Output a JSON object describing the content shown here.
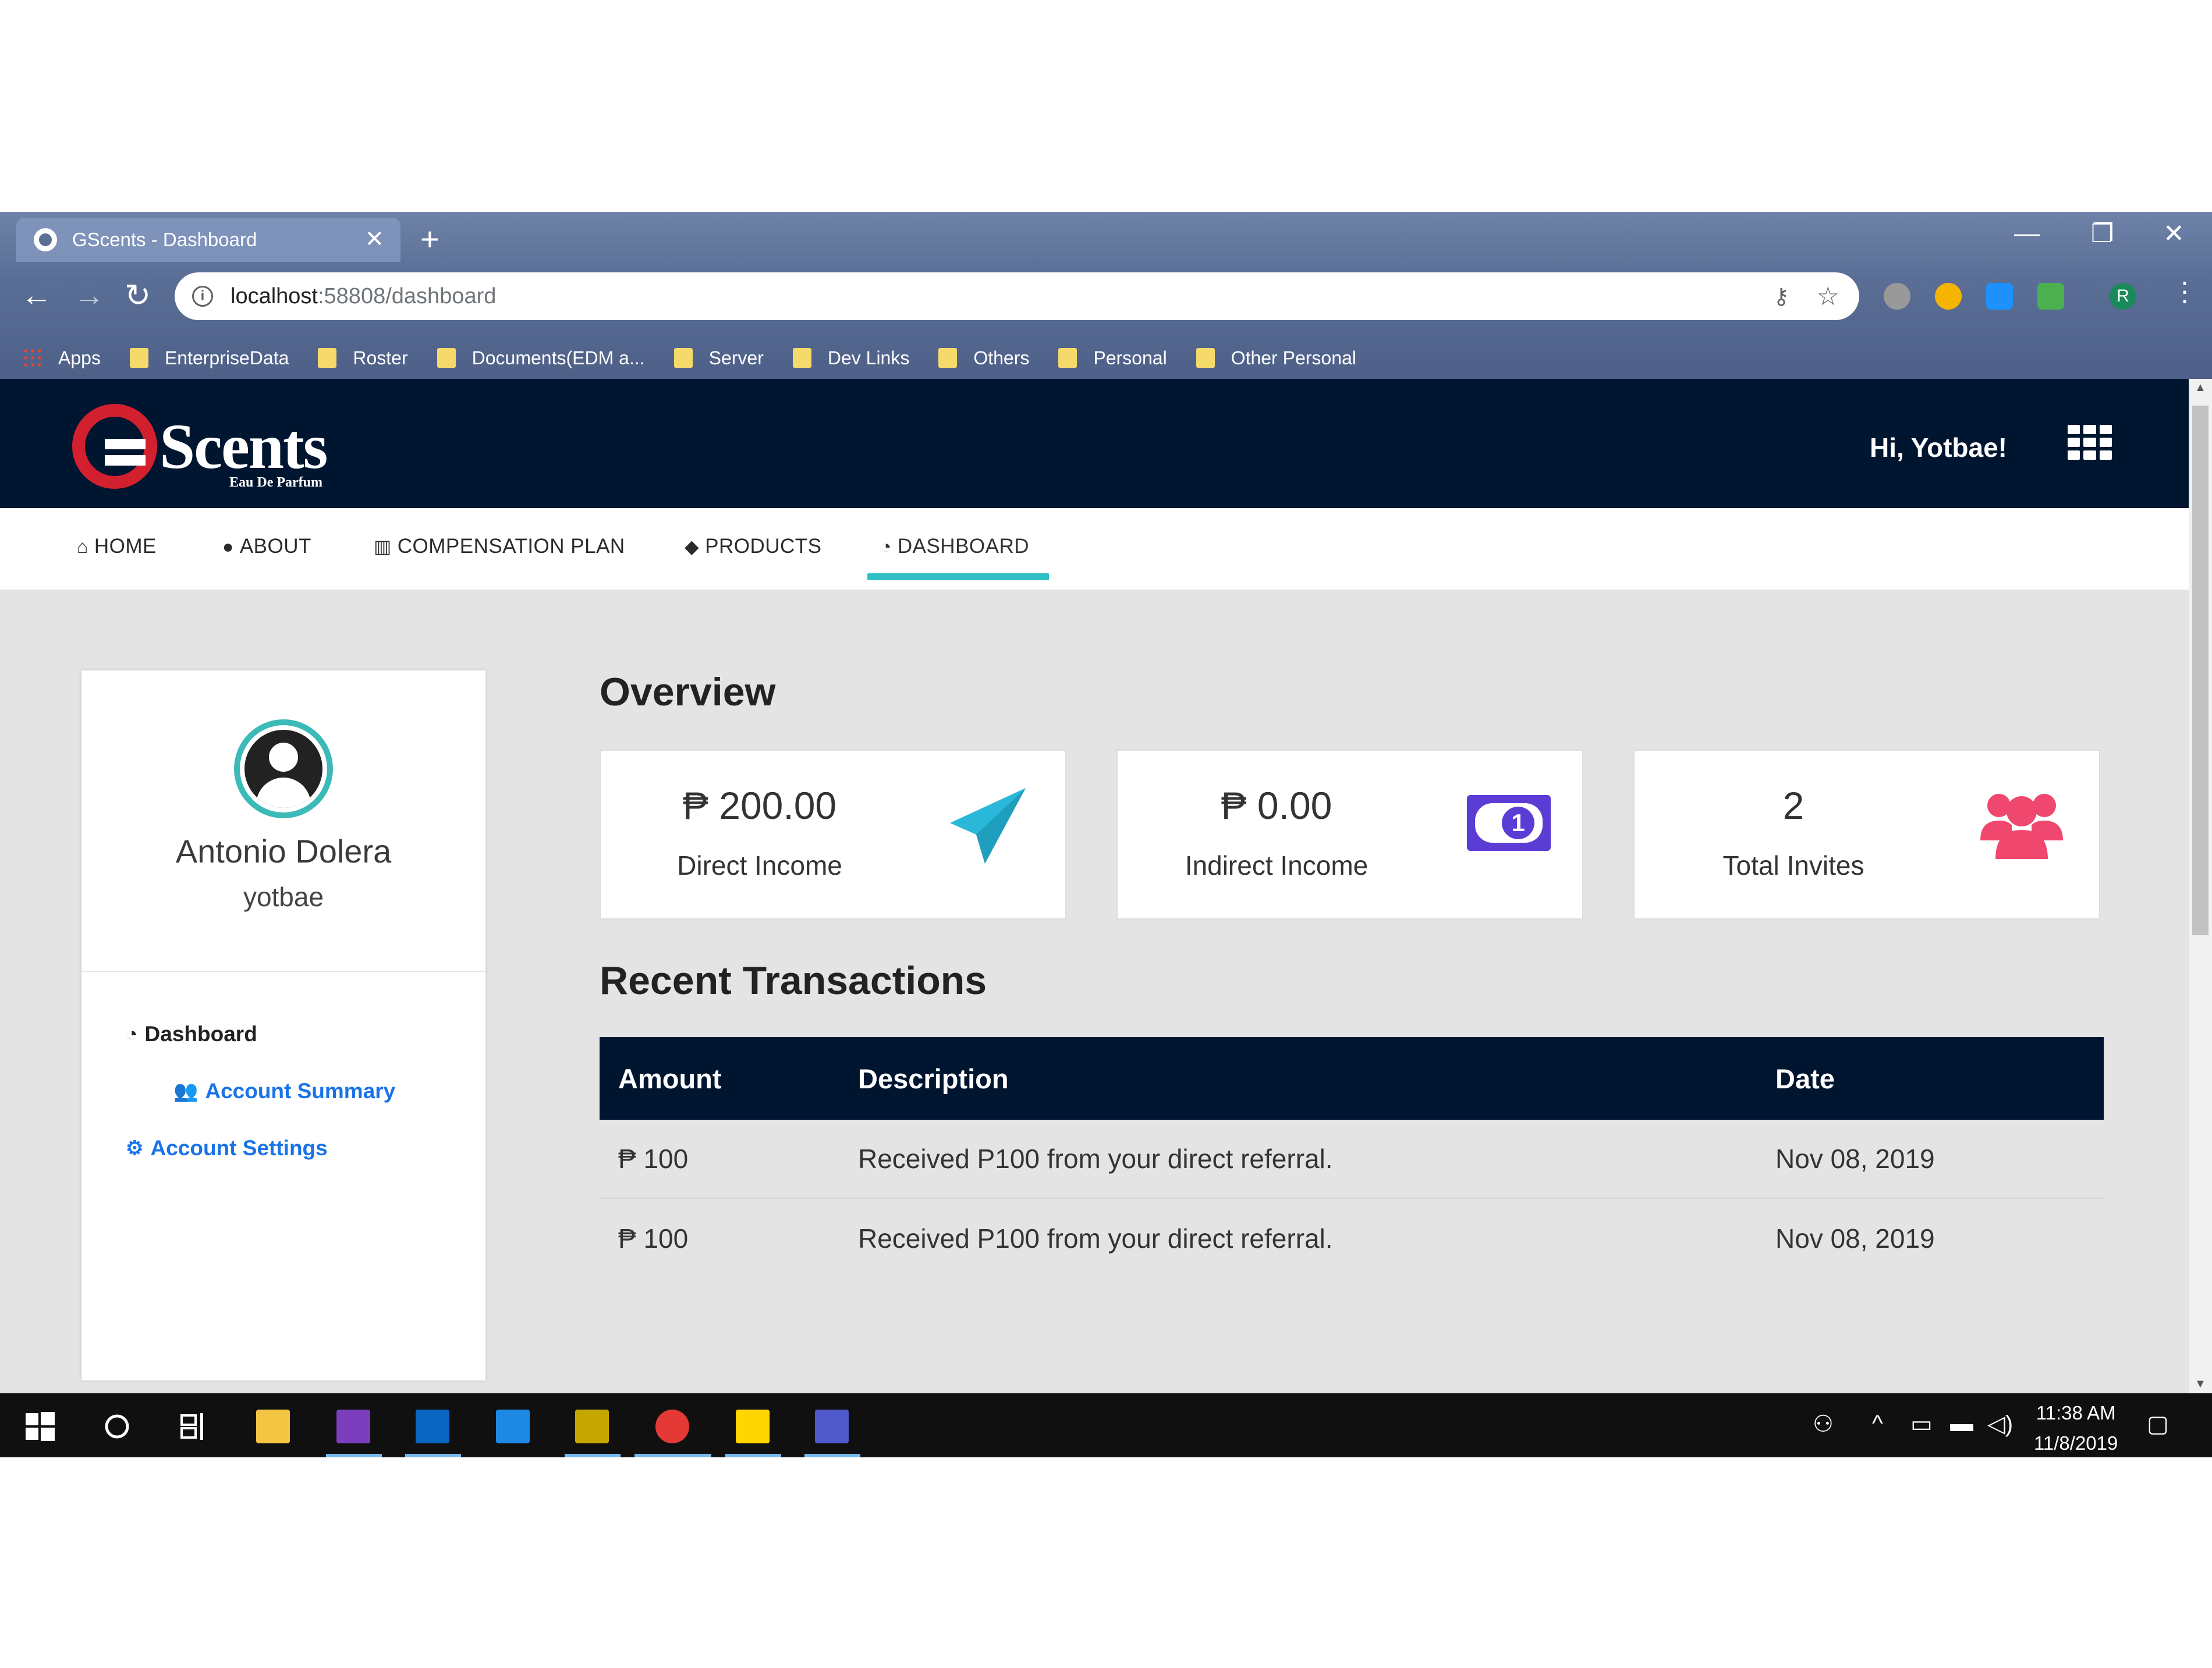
{
  "browser": {
    "tab_title": "GScents - Dashboard",
    "url_host": "localhost",
    "url_path": ":58808/dashboard",
    "bookmarks": [
      "Apps",
      "EnterpriseData",
      "Roster",
      "Documents(EDM a...",
      "Server",
      "Dev Links",
      "Others",
      "Personal",
      "Other Personal"
    ],
    "profile_initial": "R"
  },
  "site": {
    "logo_text": "Scents",
    "logo_subtitle": "Eau De Parfum",
    "greeting": "Hi, Yotbae!",
    "nav": [
      "HOME",
      "ABOUT",
      "COMPENSATION PLAN",
      "PRODUCTS",
      "DASHBOARD"
    ],
    "active_nav": "DASHBOARD"
  },
  "profile": {
    "name": "Antonio Dolera",
    "username": "yotbae",
    "menu": {
      "dashboard": "Dashboard",
      "account_summary": "Account Summary",
      "account_settings": "Account Settings"
    }
  },
  "overview": {
    "title": "Overview",
    "cards": [
      {
        "value": "₱ 200.00",
        "label": "Direct Income",
        "icon": "paper-plane-icon",
        "color": "#29b8d9"
      },
      {
        "value": "₱ 0.00",
        "label": "Indirect Income",
        "icon": "money-bill-icon",
        "color": "#5b3dd6"
      },
      {
        "value": "2",
        "label": "Total Invites",
        "icon": "users-icon",
        "color": "#f0476f"
      }
    ]
  },
  "transactions": {
    "title": "Recent Transactions",
    "columns": [
      "Amount",
      "Description",
      "Date"
    ],
    "rows": [
      {
        "amount": "₱ 100",
        "description": "Received P100 from your direct referral.",
        "date": "Nov 08, 2019"
      },
      {
        "amount": "₱ 100",
        "description": "Received P100 from your direct referral.",
        "date": "Nov 08, 2019"
      }
    ]
  },
  "taskbar": {
    "time": "11:38 AM",
    "date": "11/8/2019"
  },
  "colors": {
    "header_bg": "#001530",
    "accent": "#2fbfc4",
    "link": "#1a73e8"
  }
}
